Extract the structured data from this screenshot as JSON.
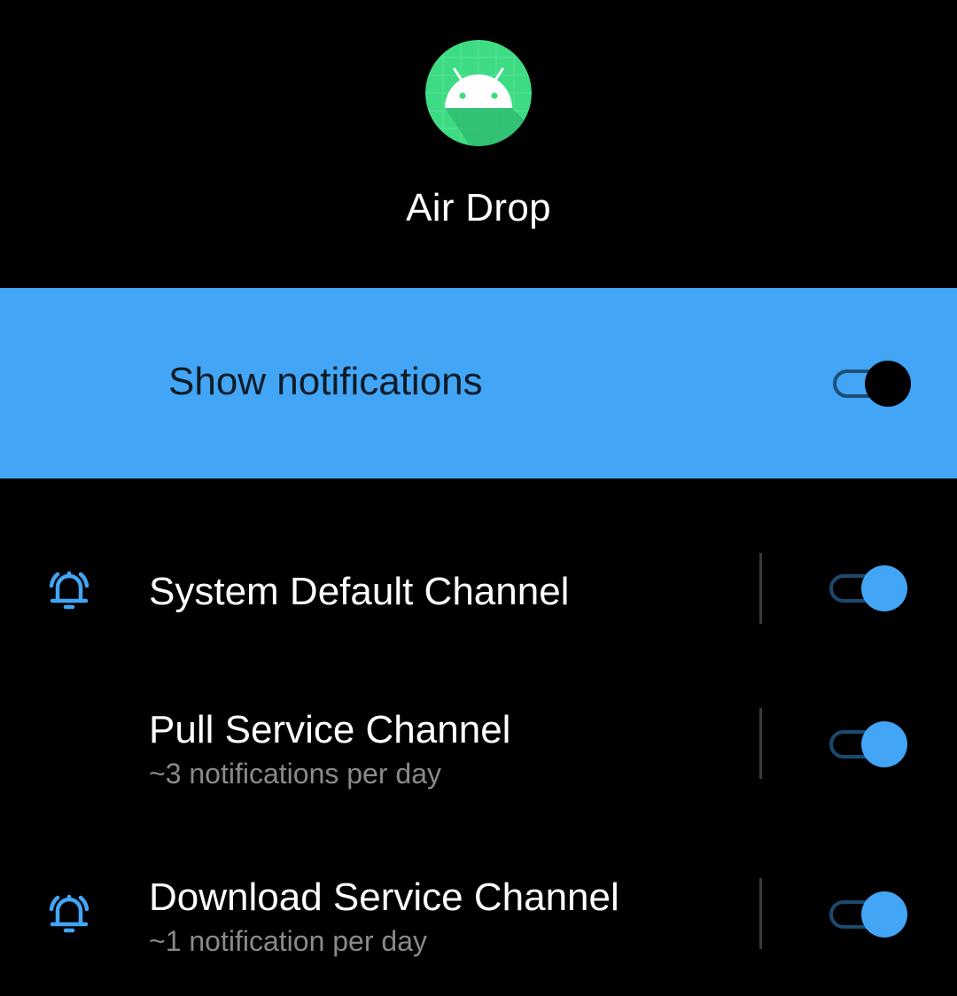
{
  "app": {
    "name": "Air Drop",
    "icon": "android-robot-icon",
    "icon_color": "#3ddc84"
  },
  "master": {
    "label": "Show notifications",
    "enabled": true,
    "background": "#42a5f5"
  },
  "channels": [
    {
      "title": "System Default Channel",
      "subtitle": "",
      "icon": "bell-ringing-icon",
      "enabled": true
    },
    {
      "title": "Pull Service Channel",
      "subtitle": "~3 notifications per day",
      "icon": "",
      "enabled": true
    },
    {
      "title": "Download Service Channel",
      "subtitle": "~1 notification per day",
      "icon": "bell-ringing-icon",
      "enabled": true
    }
  ],
  "colors": {
    "accent": "#42a5f5",
    "background": "#000000",
    "subtitle_text": "#8a8a8a"
  }
}
